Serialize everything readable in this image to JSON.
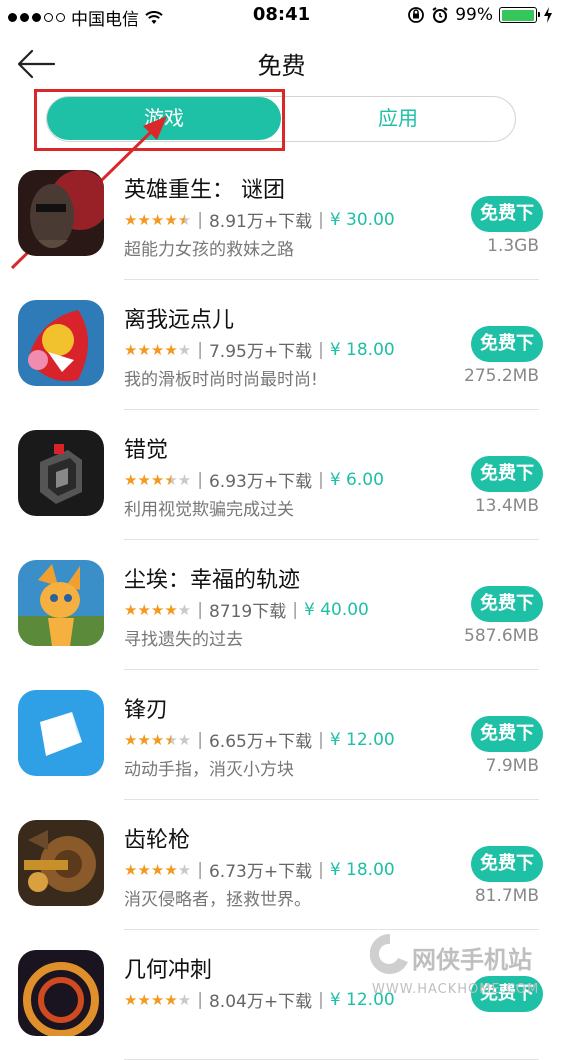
{
  "status_bar": {
    "carrier": "中国电信",
    "time": "08:41",
    "battery_percent": "99%",
    "battery_level": 0.99
  },
  "nav": {
    "title": "免费"
  },
  "tabs": {
    "games": "游戏",
    "apps": "应用",
    "selected": "games"
  },
  "apps": [
    {
      "name": "英雄重生： 谜团",
      "rating": 4.5,
      "downloads": "8.91万+下载",
      "price": "¥ 30.00",
      "description": "超能力女孩的救妹之路",
      "button": "免费下",
      "size": "1.3GB"
    },
    {
      "name": "离我远点儿",
      "rating": 4,
      "downloads": "7.95万+下载",
      "price": "¥ 18.00",
      "description": "我的滑板时尚时尚最时尚!",
      "button": "免费下",
      "size": "275.2MB"
    },
    {
      "name": "错觉",
      "rating": 3.5,
      "downloads": "6.93万+下载",
      "price": "¥ 6.00",
      "description": "利用视觉欺骗完成过关",
      "button": "免费下",
      "size": "13.4MB"
    },
    {
      "name": "尘埃：幸福的轨迹",
      "rating": 4,
      "downloads": "8719下载",
      "price": "¥ 40.00",
      "description": "寻找遗失的过去",
      "button": "免费下",
      "size": "587.6MB"
    },
    {
      "name": "锋刃",
      "rating": 3.5,
      "downloads": "6.65万+下载",
      "price": "¥ 12.00",
      "description": "动动手指，消灭小方块",
      "button": "免费下",
      "size": "7.9MB"
    },
    {
      "name": "齿轮枪",
      "rating": 4,
      "downloads": "6.73万+下载",
      "price": "¥ 18.00",
      "description": "消灭侵略者，拯救世界。",
      "button": "免费下",
      "size": "81.7MB"
    },
    {
      "name": "几何冲刺",
      "rating": 4,
      "downloads": "8.04万+下载",
      "price": "¥ 12.00",
      "description": "",
      "button": "免费下",
      "size": ""
    }
  ],
  "watermark": {
    "text": "网侠手机站",
    "sub": "WWW.HACKHOME.COM"
  },
  "colors": {
    "accent": "#1ec0a6",
    "star": "#f39a1e",
    "annotation": "#d9272a"
  }
}
